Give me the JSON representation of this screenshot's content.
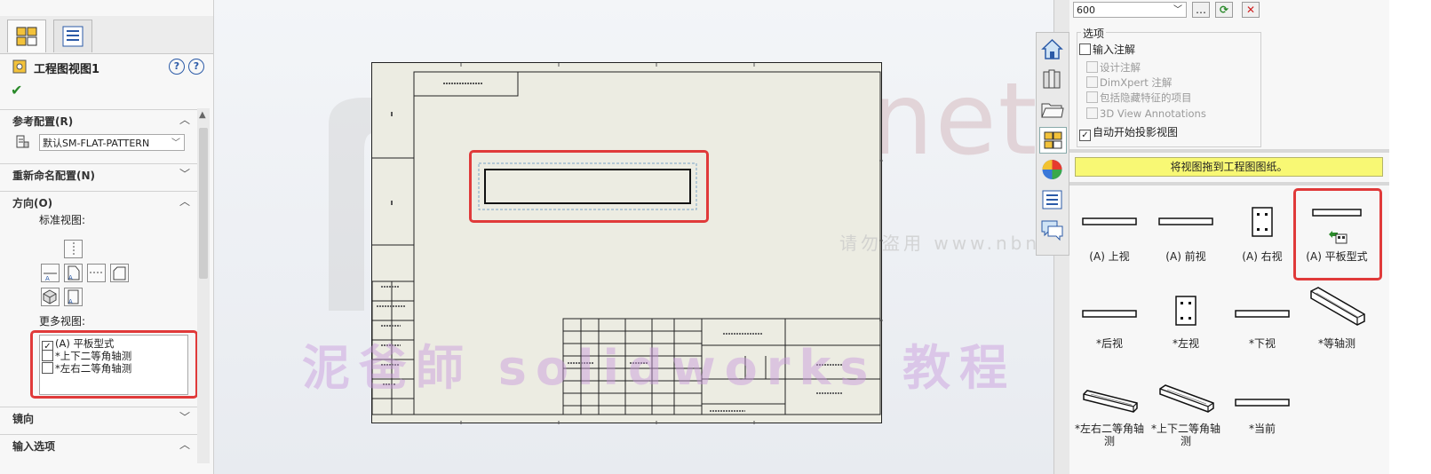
{
  "left_panel": {
    "title": "工程图视图1",
    "sections": {
      "ref_config": "参考配置(R)",
      "rename_config": "重新命名配置(N)",
      "orientation": "方向(O)",
      "mirror": "镜向",
      "import_options": "输入选项"
    },
    "config_value": "默认SM-FLAT-PATTERN",
    "standard_views_label": "标准视图:",
    "more_views_label": "更多视图:",
    "more_views": [
      {
        "label": "(A) 平板型式",
        "checked": true
      },
      {
        "label": "*上下二等角轴测",
        "checked": false
      },
      {
        "label": "*左右二等角轴测",
        "checked": false
      }
    ]
  },
  "right_panel": {
    "scale_value": "600",
    "options_legend": "选项",
    "options": [
      {
        "label": "输入注解",
        "checked": false,
        "enabled": true
      },
      {
        "label": "设计注解",
        "checked": false,
        "enabled": false
      },
      {
        "label": "DimXpert 注解",
        "checked": false,
        "enabled": false
      },
      {
        "label": "包括隐藏特征的项目",
        "checked": false,
        "enabled": false
      },
      {
        "label": "3D View Annotations",
        "checked": false,
        "enabled": false
      },
      {
        "label": "自动开始投影视图",
        "checked": true,
        "enabled": true
      }
    ],
    "banner": "将视图拖到工程图图纸。",
    "views": [
      {
        "label": "(A) 上视",
        "icon": "flat-bar-icon"
      },
      {
        "label": "(A) 前视",
        "icon": "flat-bar-icon"
      },
      {
        "label": "(A) 右视",
        "icon": "panel-holes-icon"
      },
      {
        "label": "(A) 平板型式",
        "icon": "flat-pattern-icon"
      },
      {
        "label": "*后视",
        "icon": "flat-bar-icon"
      },
      {
        "label": "*左视",
        "icon": "panel-holes-icon"
      },
      {
        "label": "*下视",
        "icon": "flat-bar-icon"
      },
      {
        "label": "*等轴测",
        "icon": "iso-bar-icon"
      },
      {
        "label": "*左右二等角轴测",
        "icon": "iso-bar-icon"
      },
      {
        "label": "*上下二等角轴测",
        "icon": "iso-bar-icon"
      },
      {
        "label": "*当前",
        "icon": "flat-bar-icon"
      }
    ]
  },
  "watermarks": {
    "site": "nbnq.net",
    "small": "请勿盗用 www.nbnq.net",
    "course": "泥爸師 solidworks 教程"
  }
}
